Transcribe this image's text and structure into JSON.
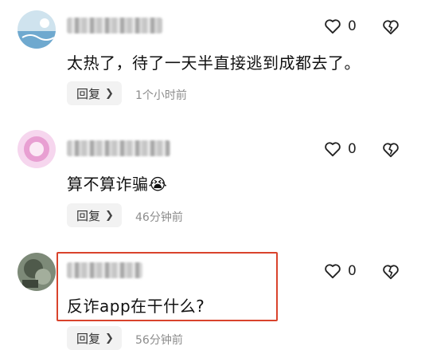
{
  "comments": [
    {
      "text": "太热了，待了一天半直接逃到成都去了。",
      "like_count": "0",
      "reply_label": "回复",
      "time": "1个小时前"
    },
    {
      "text": "算不算诈骗😭",
      "like_count": "0",
      "reply_label": "回复",
      "time": "46分钟前"
    },
    {
      "text": "反诈app在干什么?",
      "like_count": "0",
      "reply_label": "回复",
      "time": "56分钟前"
    }
  ],
  "icons": {
    "like": "heart-outline-icon",
    "dislike": "broken-heart-icon",
    "reply_chevron": "chevron-right-icon"
  },
  "colors": {
    "highlight": "#d9432c",
    "reply_bg": "#f2f2f2",
    "time_text": "#8c8c8c"
  }
}
